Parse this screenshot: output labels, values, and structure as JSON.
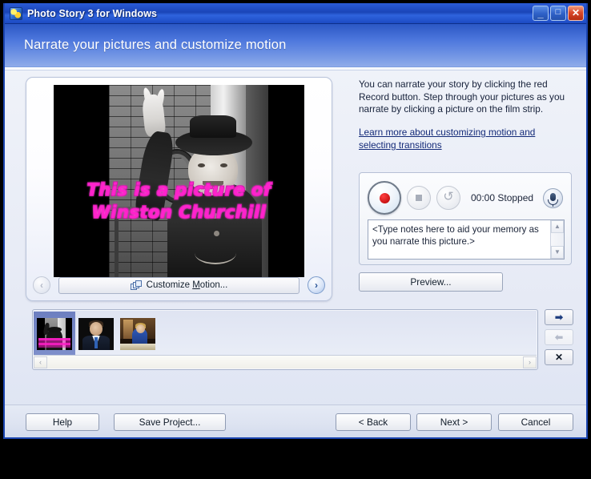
{
  "window": {
    "title": "Photo Story 3 for Windows",
    "app_icon": "photo-story-icon",
    "minimize_glyph": "_",
    "maximize_glyph": "□",
    "close_glyph": "✕",
    "accent_color": "#1a45b8",
    "header_color": "#4d77dd"
  },
  "header": {
    "page_title": "Narrate your pictures and customize motion"
  },
  "preview": {
    "caption_line1": "This is a picture of",
    "caption_line2": "Winston Churchill",
    "caption_color": "#ff22cc",
    "prev_arrow_glyph": "‹",
    "next_arrow_glyph": "›",
    "customize_motion_pre": "Customize ",
    "customize_motion_accel": "M",
    "customize_motion_post": "otion..."
  },
  "instructions": {
    "body": "You can narrate your story by clicking the red Record button. Step through your pictures as you narrate by clicking a picture on the film strip.",
    "link": "Learn more about customizing motion and selecting transitions"
  },
  "recording": {
    "record_icon": "record-circle-icon",
    "stop_icon": "stop-square-icon",
    "undo_icon": "undo-arrow-icon",
    "undo_glyph": "↺",
    "timer": "00:00",
    "status": "Stopped",
    "status_line": "00:00  Stopped",
    "mic_icon": "microphone-icon",
    "notes_placeholder": "<Type notes here to aid your memory as you narrate this picture.>",
    "notes_value": "",
    "scroll_up_glyph": "▲",
    "scroll_down_glyph": "▼"
  },
  "preview_button": {
    "label": "Preview..."
  },
  "filmstrip": {
    "thumbnails": [
      {
        "name": "churchill-victory-photo",
        "selected": true
      },
      {
        "name": "man-in-suit-photo",
        "selected": false
      },
      {
        "name": "woman-at-desk-photo",
        "selected": false
      }
    ],
    "scroll_left_glyph": "‹",
    "scroll_right_glyph": "›",
    "side_buttons": [
      {
        "name": "move-right-button",
        "glyph": "➡",
        "enabled": true
      },
      {
        "name": "move-left-button",
        "glyph": "⬅",
        "enabled": false
      },
      {
        "name": "delete-picture-button",
        "glyph": "✕",
        "enabled": true
      }
    ]
  },
  "footer": {
    "help": "Help",
    "save_project": "Save Project...",
    "back": "< Back",
    "next": "Next >",
    "cancel": "Cancel"
  }
}
